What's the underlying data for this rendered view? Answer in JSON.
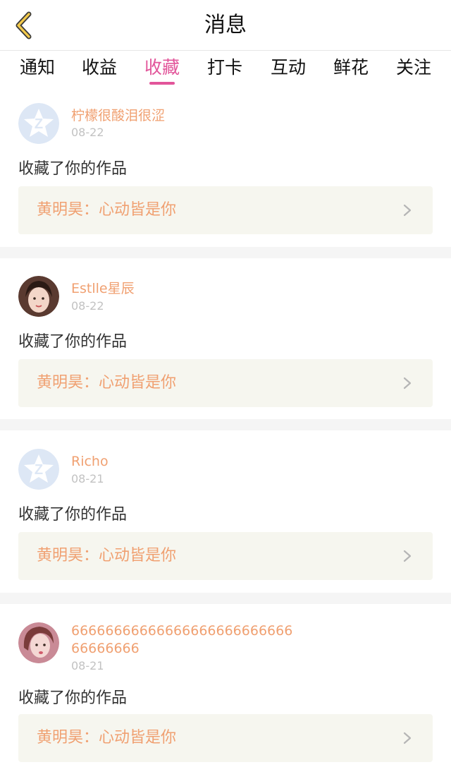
{
  "header": {
    "title": "消息",
    "back_icon": "chevron-left-icon"
  },
  "tabs": [
    {
      "label": "通知",
      "active": false
    },
    {
      "label": "收益",
      "active": false
    },
    {
      "label": "收藏",
      "active": true
    },
    {
      "label": "打卡",
      "active": false
    },
    {
      "label": "互动",
      "active": false
    },
    {
      "label": "鲜花",
      "active": false
    },
    {
      "label": "关注",
      "active": false
    }
  ],
  "messages": [
    {
      "username": "柠檬很酸泪很涩",
      "date": "08-22",
      "action": "收藏了你的作品",
      "work": "黄明昊：心动皆是你",
      "avatar": "default-avatar-icon"
    },
    {
      "username": "Estlle星辰",
      "date": "08-22",
      "action": "收藏了你的作品",
      "work": "黄明昊：心动皆是你",
      "avatar": "user-photo-avatar"
    },
    {
      "username": "Richo",
      "date": "08-21",
      "action": "收藏了你的作品",
      "work": "黄明昊：心动皆是你",
      "avatar": "default-avatar-icon"
    },
    {
      "username": "6666666666666666666666666666666666",
      "date": "08-21",
      "action": "收藏了你的作品",
      "work": "黄明昊：心动皆是你",
      "avatar": "user-photo-avatar"
    }
  ],
  "colors": {
    "accent": "#e2559a",
    "username": "#f0a071",
    "work_bg": "#f6f6ef",
    "divider": "#f5f5f5"
  }
}
